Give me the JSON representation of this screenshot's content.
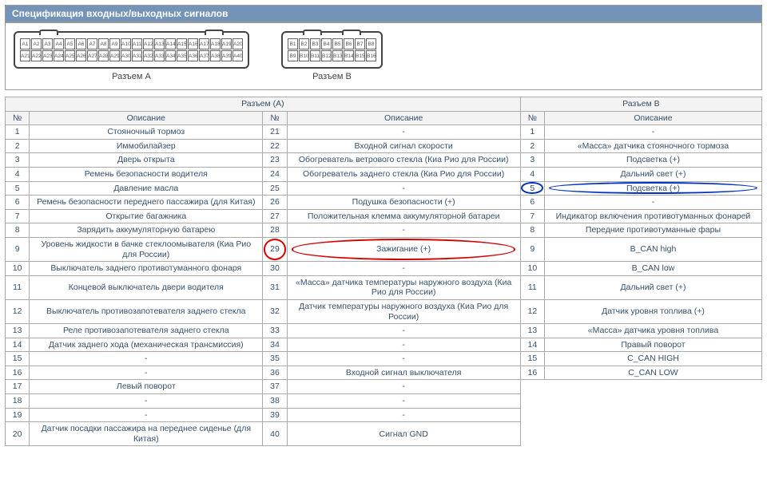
{
  "title": "Спецификация входных/выходных сигналов",
  "connectorA_label": "Разъем A",
  "connectorB_label": "Разъем B",
  "headers": {
    "groupA": "Разъем (A)",
    "groupB": "Разъем B",
    "num": "№",
    "desc": "Описание"
  },
  "rows": [
    {
      "a1n": "1",
      "a1d": "Стояночный тормоз",
      "a2n": "21",
      "a2d": "-",
      "bn": "1",
      "bd": "-"
    },
    {
      "a1n": "2",
      "a1d": "Иммобилайзер",
      "a2n": "22",
      "a2d": "Входной сигнал скорости",
      "bn": "2",
      "bd": "«Масса» датчика стояночного тормоза"
    },
    {
      "a1n": "3",
      "a1d": "Дверь открыта",
      "a2n": "23",
      "a2d": "Обогреватель ветрового стекла (Киа Рио для России)",
      "bn": "3",
      "bd": "Подсветка (+)"
    },
    {
      "a1n": "4",
      "a1d": "Ремень безопасности водителя",
      "a2n": "24",
      "a2d": "Обогреватель заднего стекла (Киа Рио для России)",
      "bn": "4",
      "bd": "Дальний свет (+)"
    },
    {
      "a1n": "5",
      "a1d": "Давление масла",
      "a2n": "25",
      "a2d": "-",
      "bn": "5",
      "bd": "Подсветка (+)",
      "b_blue": true
    },
    {
      "a1n": "6",
      "a1d": "Ремень безопасности переднего пассажира (для Китая)",
      "a2n": "26",
      "a2d": "Подушка безопасности (+)",
      "bn": "6",
      "bd": "-"
    },
    {
      "a1n": "7",
      "a1d": "Открытие багажника",
      "a2n": "27",
      "a2d": "Положительная клемма аккумуляторной батареи",
      "bn": "7",
      "bd": "Индикатор включения противотуманных фонарей"
    },
    {
      "a1n": "8",
      "a1d": "Зарядить аккумуляторную батарею",
      "a2n": "28",
      "a2d": "-",
      "bn": "8",
      "bd": "Передние противотуманные фары"
    },
    {
      "a1n": "9",
      "a1d": "Уровень жидкости в бачке стеклоомывателя (Киа Рио для России)",
      "a2n": "29",
      "a2d": "Зажигание (+)",
      "bn": "9",
      "bd": "B_CAN high",
      "a2_red": true
    },
    {
      "a1n": "10",
      "a1d": "Выключатель заднего противотуманного фонаря",
      "a2n": "30",
      "a2d": "-",
      "bn": "10",
      "bd": "B_CAN low"
    },
    {
      "a1n": "11",
      "a1d": "Концевой выключатель двери водителя",
      "a2n": "31",
      "a2d": "«Масса» датчика температуры наружного воздуха (Киа Рио для России)",
      "bn": "11",
      "bd": "Дальний свет (+)"
    },
    {
      "a1n": "12",
      "a1d": "Выключатель противозапотевателя заднего стекла",
      "a2n": "32",
      "a2d": "Датчик температуры наружного воздуха (Киа Рио для России)",
      "bn": "12",
      "bd": "Датчик уровня топлива (+)"
    },
    {
      "a1n": "13",
      "a1d": "Реле противозапотевателя заднего стекла",
      "a2n": "33",
      "a2d": "-",
      "bn": "13",
      "bd": "«Масса» датчика уровня топлива"
    },
    {
      "a1n": "14",
      "a1d": "Датчик заднего хода (механическая трансмиссия)",
      "a2n": "34",
      "a2d": "-",
      "bn": "14",
      "bd": "Правый поворот"
    },
    {
      "a1n": "15",
      "a1d": "-",
      "a2n": "35",
      "a2d": "-",
      "bn": "15",
      "bd": "C_CAN HIGH"
    },
    {
      "a1n": "16",
      "a1d": "-",
      "a2n": "36",
      "a2d": "Входной сигнал выключателя",
      "bn": "16",
      "bd": "C_CAN LOW"
    },
    {
      "a1n": "17",
      "a1d": "Левый поворот",
      "a2n": "37",
      "a2d": "-",
      "bn": "",
      "bd": ""
    },
    {
      "a1n": "18",
      "a1d": "-",
      "a2n": "38",
      "a2d": "-",
      "bn": "",
      "bd": ""
    },
    {
      "a1n": "19",
      "a1d": "-",
      "a2n": "39",
      "a2d": "-",
      "bn": "",
      "bd": ""
    },
    {
      "a1n": "20",
      "a1d": "Датчик посадки пассажира на переднее сиденье (для Китая)",
      "a2n": "40",
      "a2d": "Сигнал GND",
      "bn": "",
      "bd": ""
    }
  ]
}
